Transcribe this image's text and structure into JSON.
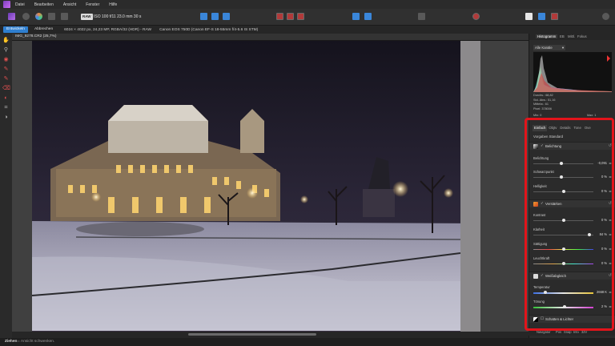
{
  "menu": [
    "Datei",
    "Bearbeiten",
    "Ansicht",
    "Fenster",
    "Hilfe"
  ],
  "toolbar": {
    "raw_badge": "RAW",
    "exif": "ISO 100  f/11  23.0 mm  30 s"
  },
  "context": {
    "develop_label": "Entwickeln",
    "cancel_label": "Abbrechen",
    "image_info": "6024 × 4022 px, 24,23 MP, RGBA/32 (HDR) - RAW",
    "camera": "Canon EOS 750D (Canon EF-S 18-55mm f/4-5.6 IS STM)"
  },
  "document": {
    "title": "IMG_9278.CR2 (25,7%)"
  },
  "status": {
    "bold": "Ziehen",
    "rest": "= Ansicht schwenken."
  },
  "panel": {
    "tabs": [
      "Histogramm",
      "EB",
      "Mittl.",
      "Fokus"
    ],
    "hist_channel": "Alle Kanäle",
    "stats": [
      "Durchs.: 68,82",
      "Std. Abw.: 51,16",
      "Mittelw.: 61",
      "Pixel: 378006"
    ],
    "min_label": "Min: 0",
    "max_label": "Max: 1",
    "subtabs": [
      "Einfach",
      "Objtv",
      "Details",
      "Tone",
      "Ove"
    ],
    "presets_label": "Vorgaben",
    "presets_value": "Standard",
    "sections": {
      "exposure": "Belichtung",
      "enhance": "Verstärken",
      "wb": "Weißabgleich",
      "shadows": "Schatten & Lichter"
    },
    "sliders": {
      "exposure": {
        "label": "Belichtung",
        "value": "-0,091",
        "pos": 0.47
      },
      "blackpoint": {
        "label": "Schwarzpunkt",
        "value": "0 %",
        "pos": 0.47
      },
      "brightness": {
        "label": "Helligkeit",
        "value": "0 %",
        "pos": 0.5
      },
      "contrast": {
        "label": "Kontrast",
        "value": "0 %",
        "pos": 0.5
      },
      "clarity": {
        "label": "Klarheit",
        "value": "84 %",
        "pos": 0.93
      },
      "saturation": {
        "label": "Sättigung",
        "value": "0 %",
        "pos": 0.5
      },
      "vibrance": {
        "label": "Leuchtkraft",
        "value": "0 %",
        "pos": 0.5
      },
      "temperature": {
        "label": "Temperatur",
        "value": "2668 K",
        "pos": 0.2
      },
      "tint": {
        "label": "Tönung",
        "value": "2 %",
        "pos": 0.52
      }
    },
    "bottom_tabs": [
      "Navigator",
      "Pos",
      "Snap",
      "Info",
      "32V"
    ]
  }
}
